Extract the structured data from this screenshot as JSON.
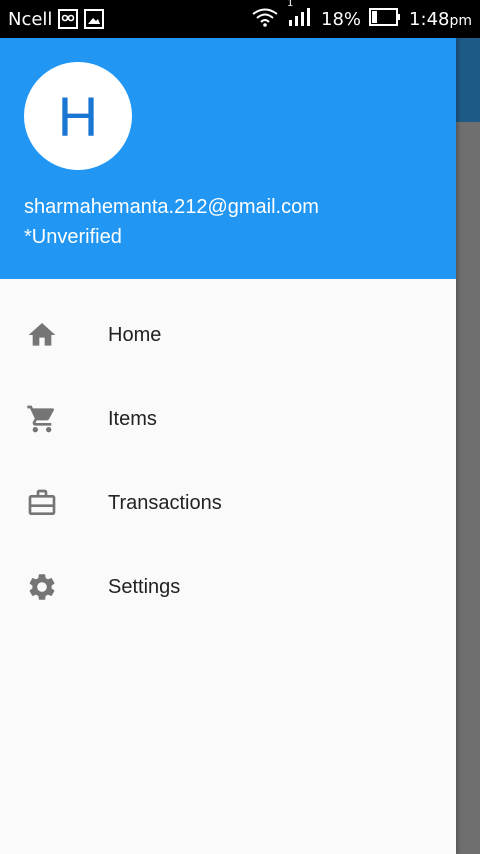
{
  "status_bar": {
    "carrier": "Ncell",
    "battery": "18%",
    "time": "1:48",
    "time_suffix": "pm",
    "signal_badge": "1"
  },
  "drawer": {
    "avatar_letter": "H",
    "email": "sharmahemanta.212@gmail.com",
    "verification": "*Unverified",
    "items": [
      {
        "label": "Home",
        "icon": "home-icon"
      },
      {
        "label": "Items",
        "icon": "cart-icon"
      },
      {
        "label": "Transactions",
        "icon": "briefcase-icon"
      },
      {
        "label": "Settings",
        "icon": "gear-icon"
      }
    ]
  },
  "colors": {
    "header": "#2196f3",
    "avatar_text": "#1976d2",
    "icon": "#757575"
  }
}
